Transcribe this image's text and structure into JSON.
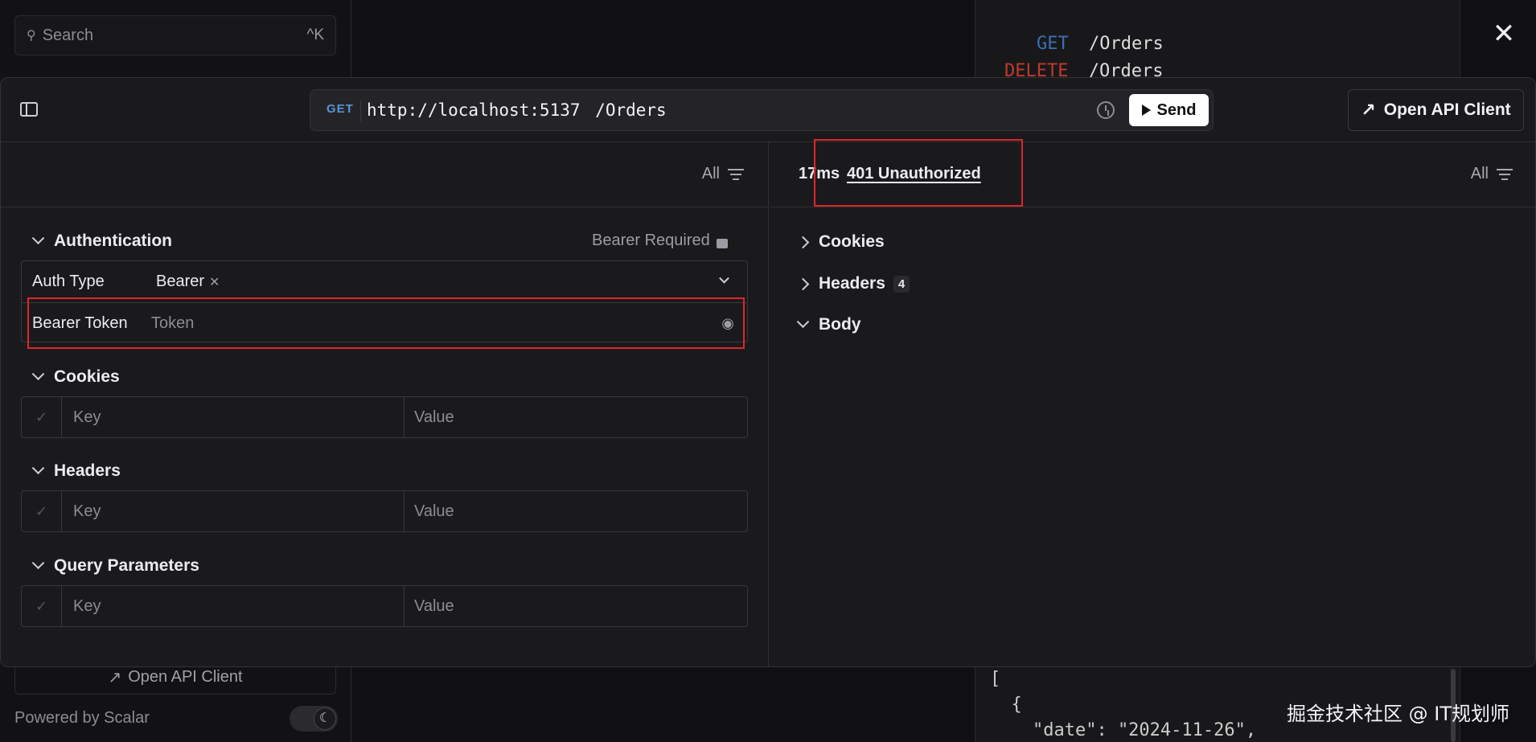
{
  "background": {
    "search_placeholder": "Search",
    "search_shortcut": "^K",
    "endpoints": [
      {
        "method": "GET",
        "path": "/Orders",
        "color": "#3b6fb0"
      },
      {
        "method": "DELETE",
        "path": "/Orders",
        "color": "#c0392b"
      }
    ],
    "open_api_client": "Open API Client",
    "powered_by": "Powered by Scalar",
    "code_lines": [
      "[",
      "  {",
      "    \"date\": \"2024-11-26\","
    ],
    "watermark": "掘金技术社区 @ IT规划师"
  },
  "toolbar": {
    "method": "GET",
    "url": "http://localhost:5137",
    "path": "/Orders",
    "send_label": "Send",
    "open_api_client_label": "Open API Client"
  },
  "request": {
    "filter_label": "All",
    "authentication": {
      "title": "Authentication",
      "status": "Bearer Required",
      "auth_type_label": "Auth Type",
      "auth_type_value": "Bearer",
      "bearer_token_label": "Bearer Token",
      "bearer_token_placeholder": "Token"
    },
    "cookies": {
      "title": "Cookies",
      "key_placeholder": "Key",
      "value_placeholder": "Value"
    },
    "headers": {
      "title": "Headers",
      "key_placeholder": "Key",
      "value_placeholder": "Value"
    },
    "query": {
      "title": "Query Parameters",
      "key_placeholder": "Key",
      "value_placeholder": "Value"
    }
  },
  "response": {
    "time": "17ms",
    "status": "401 Unauthorized",
    "filter_label": "All",
    "sections": {
      "cookies": "Cookies",
      "headers": "Headers",
      "headers_count": "4",
      "body": "Body"
    }
  },
  "colors": {
    "highlight": "#e0242c",
    "get_badge": "#5b93d6",
    "delete": "#c0392b"
  }
}
